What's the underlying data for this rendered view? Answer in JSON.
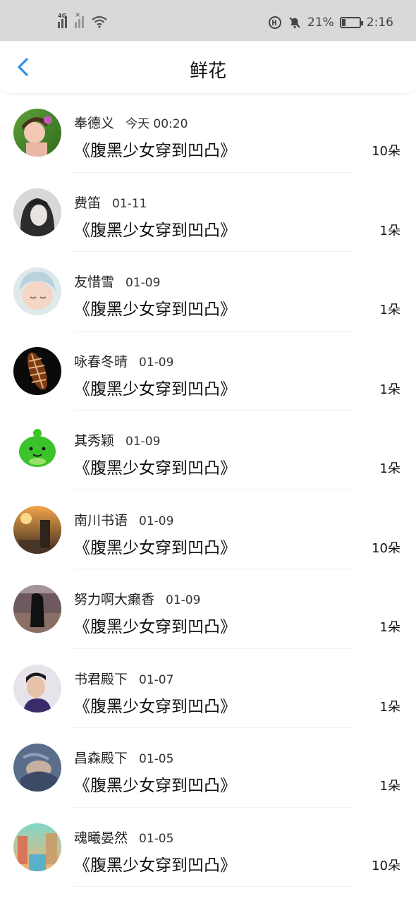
{
  "status_bar": {
    "network_label": "4G",
    "battery_percent": "21%",
    "battery_level": 0.21,
    "time": "2:16",
    "icons": [
      "signal-icon",
      "signal-icon",
      "wifi-icon",
      "hd-icon",
      "bell-muted-icon",
      "battery-icon"
    ]
  },
  "header": {
    "back_icon": "chevron-left-icon",
    "title": "鲜花"
  },
  "list": [
    {
      "name": "奉德义",
      "date": "今天 00:20",
      "book": "《腹黑少女穿到凹凸》",
      "count": "10朵"
    },
    {
      "name": "费笛",
      "date": "01-11",
      "book": "《腹黑少女穿到凹凸》",
      "count": "1朵"
    },
    {
      "name": "友惜雪",
      "date": "01-09",
      "book": "《腹黑少女穿到凹凸》",
      "count": "1朵"
    },
    {
      "name": "咏春冬晴",
      "date": "01-09",
      "book": "《腹黑少女穿到凹凸》",
      "count": "1朵"
    },
    {
      "name": "其秀颖",
      "date": "01-09",
      "book": "《腹黑少女穿到凹凸》",
      "count": "1朵"
    },
    {
      "name": "南川书语",
      "date": "01-09",
      "book": "《腹黑少女穿到凹凸》",
      "count": "10朵"
    },
    {
      "name": "努力啊大癞香",
      "date": "01-09",
      "book": "《腹黑少女穿到凹凸》",
      "count": "1朵"
    },
    {
      "name": "书君殿下",
      "date": "01-07",
      "book": "《腹黑少女穿到凹凸》",
      "count": "1朵"
    },
    {
      "name": "昌森殿下",
      "date": "01-05",
      "book": "《腹黑少女穿到凹凸》",
      "count": "1朵"
    },
    {
      "name": "魂曦晏然",
      "date": "01-05",
      "book": "《腹黑少女穿到凹凸》",
      "count": "10朵"
    }
  ],
  "colors": {
    "accent": "#2e8fe6",
    "status_bar_bg": "#d9d9d9"
  }
}
